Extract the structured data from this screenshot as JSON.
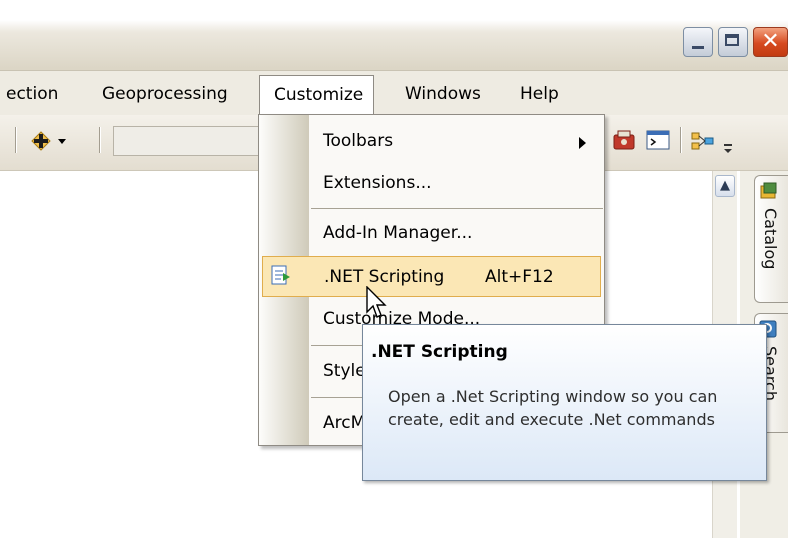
{
  "menubar": {
    "items": [
      "ection",
      "Geoprocessing",
      "Customize",
      "Windows",
      "Help"
    ]
  },
  "dropdown": {
    "items": [
      {
        "label": "Toolbars",
        "has_submenu": true
      },
      {
        "label": "Extensions..."
      },
      {
        "label": "Add-In Manager..."
      },
      {
        "label": ".NET Scripting",
        "shortcut": "Alt+F12",
        "highlighted": true,
        "icon": "net-scripting-icon"
      },
      {
        "label": "Customize Mode..."
      },
      {
        "label": "Style Manager..."
      },
      {
        "label": "ArcMap Options..."
      }
    ]
  },
  "tooltip": {
    "title": ".NET Scripting",
    "body": "Open a .Net Scripting window so you can create, edit and execute .Net commands"
  },
  "side_tabs": [
    "Catalog",
    "Search"
  ],
  "window_controls": [
    "minimize",
    "maximize",
    "close"
  ],
  "colors": {
    "highlight": "#fbe7b5",
    "tooltip": "#dce8f7",
    "close_button": "#d64a20"
  }
}
